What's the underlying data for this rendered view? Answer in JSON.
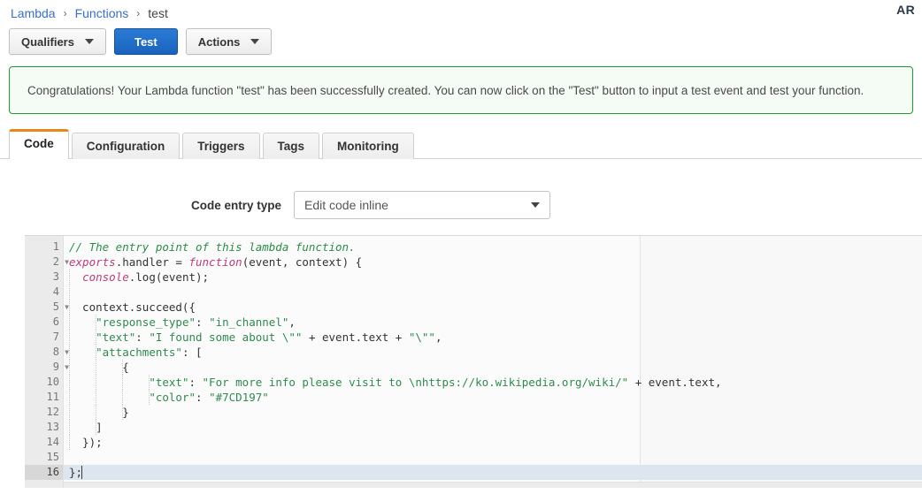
{
  "breadcrumb": {
    "items": [
      {
        "label": "Lambda",
        "link": true
      },
      {
        "label": "Functions",
        "link": true
      },
      {
        "label": "test",
        "link": false
      }
    ],
    "separator": "›"
  },
  "header": {
    "account_label": "AR"
  },
  "toolbar": {
    "qualifiers_label": "Qualifiers",
    "test_label": "Test",
    "actions_label": "Actions"
  },
  "alert": {
    "message": "Congratulations! Your Lambda function \"test\" has been successfully created. You can now click on the \"Test\" button to input a test event and test your function.",
    "border_color": "#1f9a34",
    "background_color": "#f4fcf5"
  },
  "tabs": {
    "active_index": 0,
    "active_accent_color": "#e8881a",
    "items": [
      {
        "label": "Code"
      },
      {
        "label": "Configuration"
      },
      {
        "label": "Triggers"
      },
      {
        "label": "Tags"
      },
      {
        "label": "Monitoring"
      }
    ]
  },
  "code_entry": {
    "label": "Code entry type",
    "selected": "Edit code inline"
  },
  "editor": {
    "active_line": 16,
    "fold_lines": [
      2,
      5,
      8,
      9
    ],
    "lines": [
      {
        "n": 1,
        "indent": 0,
        "tokens": [
          {
            "t": "// The entry point of this lambda function.",
            "c": "cm"
          }
        ]
      },
      {
        "n": 2,
        "indent": 0,
        "tokens": [
          {
            "t": "exports",
            "c": "kw"
          },
          {
            "t": ".handler = ",
            "c": "pl"
          },
          {
            "t": "function",
            "c": "kw"
          },
          {
            "t": "(event, context) {",
            "c": "pl"
          }
        ]
      },
      {
        "n": 3,
        "indent": 1,
        "tokens": [
          {
            "t": "  ",
            "c": "pl"
          },
          {
            "t": "console",
            "c": "kw"
          },
          {
            "t": ".log(event);",
            "c": "pl"
          }
        ]
      },
      {
        "n": 4,
        "indent": 1,
        "tokens": [
          {
            "t": "",
            "c": "pl"
          }
        ]
      },
      {
        "n": 5,
        "indent": 1,
        "tokens": [
          {
            "t": "  context.succeed({",
            "c": "pl"
          }
        ]
      },
      {
        "n": 6,
        "indent": 2,
        "tokens": [
          {
            "t": "    ",
            "c": "pl"
          },
          {
            "t": "\"response_type\"",
            "c": "st"
          },
          {
            "t": ": ",
            "c": "pl"
          },
          {
            "t": "\"in_channel\"",
            "c": "st"
          },
          {
            "t": ",",
            "c": "pl"
          }
        ]
      },
      {
        "n": 7,
        "indent": 2,
        "tokens": [
          {
            "t": "    ",
            "c": "pl"
          },
          {
            "t": "\"text\"",
            "c": "st"
          },
          {
            "t": ": ",
            "c": "pl"
          },
          {
            "t": "\"I found some about \\\"\"",
            "c": "st"
          },
          {
            "t": " + event.text + ",
            "c": "pl"
          },
          {
            "t": "\"\\\"\"",
            "c": "st"
          },
          {
            "t": ",",
            "c": "pl"
          }
        ]
      },
      {
        "n": 8,
        "indent": 2,
        "tokens": [
          {
            "t": "    ",
            "c": "pl"
          },
          {
            "t": "\"attachments\"",
            "c": "st"
          },
          {
            "t": ": [",
            "c": "pl"
          }
        ]
      },
      {
        "n": 9,
        "indent": 3,
        "tokens": [
          {
            "t": "        {",
            "c": "pl"
          }
        ]
      },
      {
        "n": 10,
        "indent": 4,
        "tokens": [
          {
            "t": "            ",
            "c": "pl"
          },
          {
            "t": "\"text\"",
            "c": "st"
          },
          {
            "t": ": ",
            "c": "pl"
          },
          {
            "t": "\"For more info please visit to \\nhttps://ko.wikipedia.org/wiki/\"",
            "c": "st"
          },
          {
            "t": " + event.text,",
            "c": "pl"
          }
        ]
      },
      {
        "n": 11,
        "indent": 4,
        "tokens": [
          {
            "t": "            ",
            "c": "pl"
          },
          {
            "t": "\"color\"",
            "c": "st"
          },
          {
            "t": ": ",
            "c": "pl"
          },
          {
            "t": "\"#7CD197\"",
            "c": "st"
          }
        ]
      },
      {
        "n": 12,
        "indent": 3,
        "tokens": [
          {
            "t": "        }",
            "c": "pl"
          }
        ]
      },
      {
        "n": 13,
        "indent": 2,
        "tokens": [
          {
            "t": "    ]",
            "c": "pl"
          }
        ]
      },
      {
        "n": 14,
        "indent": 1,
        "tokens": [
          {
            "t": "  });",
            "c": "pl"
          }
        ]
      },
      {
        "n": 15,
        "indent": 0,
        "tokens": [
          {
            "t": "",
            "c": "pl"
          }
        ]
      },
      {
        "n": 16,
        "indent": 0,
        "tokens": [
          {
            "t": "};",
            "c": "pl"
          }
        ]
      }
    ]
  }
}
